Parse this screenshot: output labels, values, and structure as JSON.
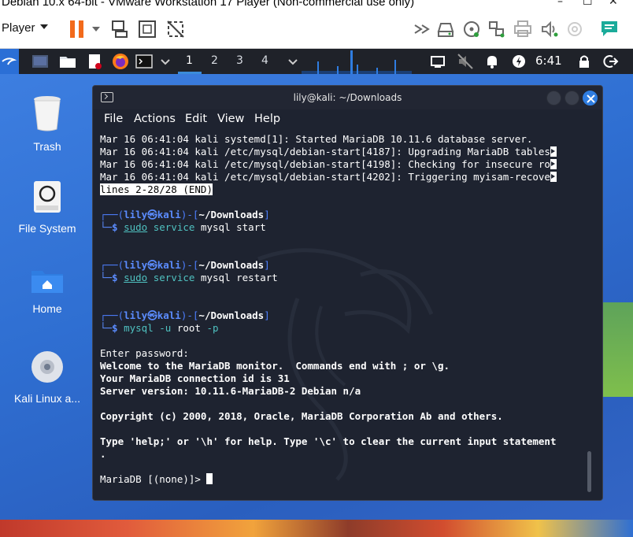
{
  "vm_window": {
    "title": "Debian 10.x 64-bit - VMware Workstation 17 Player (Non-commercial use only)",
    "controls": [
      "–",
      "☐",
      "✕"
    ]
  },
  "vm_toolbar": {
    "player_label": "Player",
    "icons": [
      "pause-icon",
      "send-ctrl-alt-del-icon",
      "fit-guest-icon",
      "unity-icon",
      "forward-arrows-icon",
      "hard-disk-icon",
      "cd-drive-icon",
      "network-adapter-icon",
      "printer-icon",
      "sound-card-icon",
      "usb-device-icon",
      "message-log-icon"
    ]
  },
  "kali_panel": {
    "workspaces": [
      "1",
      "2",
      "3",
      "4"
    ],
    "time": "6:41"
  },
  "desktop": {
    "icons": [
      {
        "label": "Trash"
      },
      {
        "label": "File System"
      },
      {
        "label": "Home"
      },
      {
        "label": "Kali Linux a..."
      }
    ]
  },
  "terminal": {
    "title": "lily@kali: ~/Downloads",
    "menu": [
      "File",
      "Actions",
      "Edit",
      "View",
      "Help"
    ],
    "log_lines": [
      "Mar 16 06:41:04 kali systemd[1]: Started MariaDB 10.11.6 database server.",
      "Mar 16 06:41:04 kali /etc/mysql/debian-start[4187]: Upgrading MariaDB tables",
      "Mar 16 06:41:04 kali /etc/mysql/debian-start[4198]: Checking for insecure ro",
      "Mar 16 06:41:04 kali /etc/mysql/debian-start[4202]: Triggering myisam-recove"
    ],
    "pager_status": "lines 2-28/28 (END)",
    "prompt": {
      "open": "┌──(",
      "user": "lily",
      "at": "㉿",
      "host": "kali",
      "mid": ")-[",
      "path": "~/Downloads",
      "close": "]",
      "second": "└─$ "
    },
    "commands": [
      {
        "prog": "sudo",
        "cmd": "service",
        "args": " mysql start"
      },
      {
        "prog": "sudo",
        "cmd": "service",
        "args": " mysql restart"
      },
      {
        "prog": "mysql",
        "flag1": " -u",
        "arg1": " root",
        "flag2": " -p"
      }
    ],
    "output": {
      "enter_password": "Enter password:",
      "welcome": "Welcome to the MariaDB monitor.  Commands end with ; or \\g.",
      "connection": "Your MariaDB connection id is 31",
      "server_version": "Server version: 10.11.6-MariaDB-2 Debian n/a",
      "copyright": "Copyright (c) 2000, 2018, Oracle, MariaDB Corporation Ab and others.",
      "help": "Type 'help;' or '\\h' for help. Type '\\c' to clear the current input statement",
      "help_wrap": ".",
      "mariadb_prompt": "MariaDB [(none)]> "
    }
  }
}
